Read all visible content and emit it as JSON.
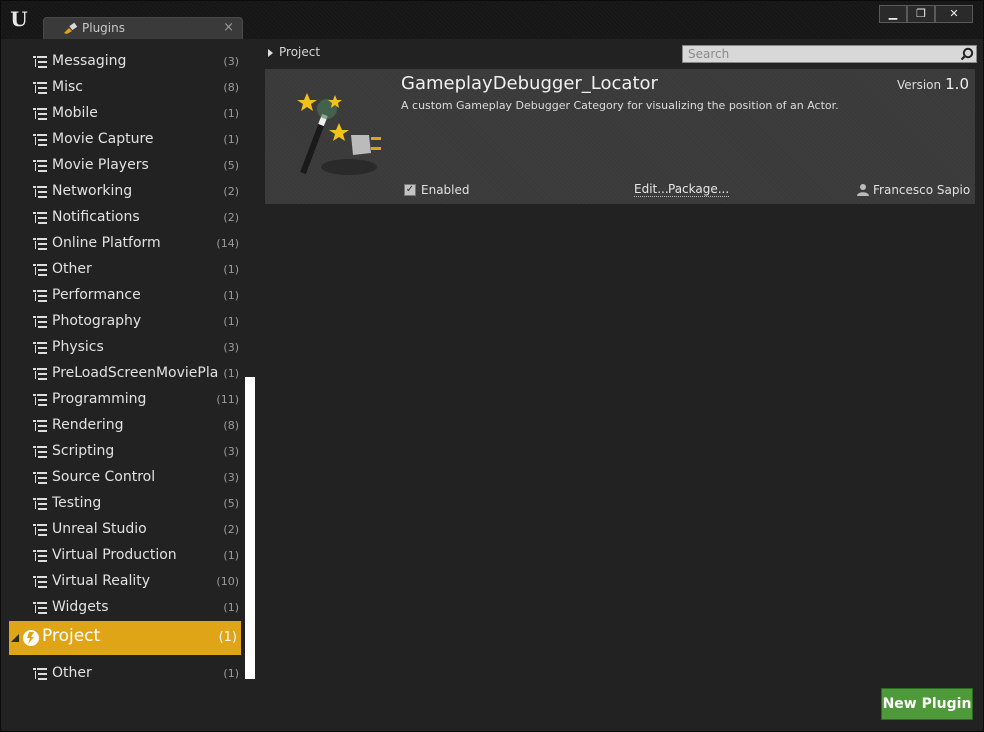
{
  "titlebar": {
    "logo_text": "U",
    "tab_label": "Plugins",
    "tab_close": "×",
    "buttons": {
      "minimize": "▁",
      "maximize": "❐",
      "close": "✕"
    }
  },
  "sidebar": {
    "items": [
      {
        "label": "Messaging",
        "count": "(3)"
      },
      {
        "label": "Misc",
        "count": "(8)"
      },
      {
        "label": "Mobile",
        "count": "(1)"
      },
      {
        "label": "Movie Capture",
        "count": "(1)"
      },
      {
        "label": "Movie Players",
        "count": "(5)"
      },
      {
        "label": "Networking",
        "count": "(2)"
      },
      {
        "label": "Notifications",
        "count": "(2)"
      },
      {
        "label": "Online Platform",
        "count": "(14)"
      },
      {
        "label": "Other",
        "count": "(1)"
      },
      {
        "label": "Performance",
        "count": "(1)"
      },
      {
        "label": "Photography",
        "count": "(1)"
      },
      {
        "label": "Physics",
        "count": "(3)"
      },
      {
        "label": "PreLoadScreenMoviePla",
        "count": "(1)"
      },
      {
        "label": "Programming",
        "count": "(11)"
      },
      {
        "label": "Rendering",
        "count": "(8)"
      },
      {
        "label": "Scripting",
        "count": "(3)"
      },
      {
        "label": "Source Control",
        "count": "(3)"
      },
      {
        "label": "Testing",
        "count": "(5)"
      },
      {
        "label": "Unreal Studio",
        "count": "(2)"
      },
      {
        "label": "Virtual Production",
        "count": "(1)"
      },
      {
        "label": "Virtual Reality",
        "count": "(10)"
      },
      {
        "label": "Widgets",
        "count": "(1)"
      }
    ],
    "project": {
      "label": "Project",
      "count": "(1)"
    },
    "project_children": [
      {
        "label": "Other",
        "count": "(1)"
      }
    ]
  },
  "breadcrumb": {
    "label": "Project"
  },
  "search": {
    "placeholder": "Search"
  },
  "plugin": {
    "name": "GameplayDebugger_Locator",
    "description": "A custom Gameplay Debugger Category for visualizing the position of an Actor.",
    "version_label": "Version",
    "version_number": "1.0",
    "enabled_label": "Enabled",
    "enabled": true,
    "edit_label": "Edit...",
    "package_label": "Package...",
    "author": "Francesco Sapio"
  },
  "footer": {
    "new_plugin_label": "New Plugin"
  },
  "colors": {
    "selected": "#e0a516",
    "new_plugin_button": "#4e9a3a",
    "panel": "#222222",
    "card": "#3a3a3a"
  }
}
